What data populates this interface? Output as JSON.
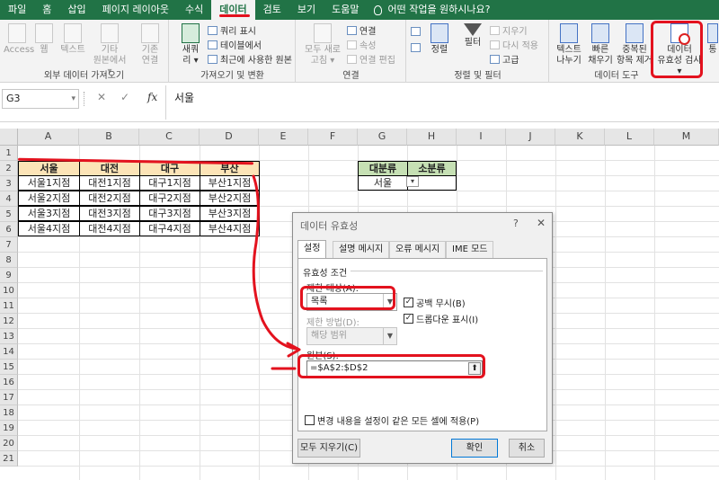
{
  "ribbon_tabs": [
    "파일",
    "홈",
    "삽입",
    "페이지 레이아웃",
    "수식",
    "데이터",
    "검토",
    "보기",
    "도움말"
  ],
  "active_tab": "데이터",
  "help_search": "어떤 작업을 원하시나요?",
  "ribbon": {
    "ext": {
      "label": "외부 데이터 가져오기",
      "access": "Access",
      "web": "웹",
      "text": "텍스트",
      "other_line1": "기타",
      "other_line2": "원본에서 ▾",
      "existing_line1": "기존",
      "existing_line2": "연결"
    },
    "get": {
      "label": "가져오기 및 변환",
      "new_query_line1": "새쿼",
      "new_query_line2": "리 ▾",
      "show_query": "쿼리 표시",
      "from_table": "테이블에서",
      "recent_sources": "최근에 사용한 원본"
    },
    "conn": {
      "label": "연결",
      "refresh_line1": "모두 새로",
      "refresh_line2": "고침 ▾",
      "connections": "연결",
      "properties": "속성",
      "edit_links": "연결 편집"
    },
    "sort": {
      "label": "정렬 및 필터",
      "sort": "정렬",
      "filter": "필터",
      "clear": "지우기",
      "reapply": "다시 적용",
      "advanced": "고급"
    },
    "tools": {
      "label": "데이터 도구",
      "text_to_cols_line1": "텍스트",
      "text_to_cols_line2": "나누기",
      "flash_fill_line1": "빠른",
      "flash_fill_line2": "채우기",
      "remove_dup_line1": "중복된",
      "remove_dup_line2": "항목 제거",
      "validation_line1": "데이터",
      "validation_line2": "유효성 검사 ▾",
      "cut_label": "통"
    }
  },
  "formula_bar": {
    "name_box": "G3",
    "formula": "서울"
  },
  "columns": [
    "A",
    "B",
    "C",
    "D",
    "E",
    "F",
    "G",
    "H",
    "I",
    "J",
    "K",
    "L",
    "M"
  ],
  "rows": [
    "1",
    "2",
    "3",
    "4",
    "5",
    "6",
    "7",
    "8",
    "9",
    "10",
    "11",
    "12",
    "13",
    "14",
    "15",
    "16",
    "17",
    "18",
    "19",
    "20",
    "21"
  ],
  "table": {
    "headers": [
      "서울",
      "대전",
      "대구",
      "부산"
    ],
    "rows": [
      [
        "서울1지점",
        "대전1지점",
        "대구1지점",
        "부산1지점"
      ],
      [
        "서울2지점",
        "대전2지점",
        "대구2지점",
        "부산2지점"
      ],
      [
        "서울3지점",
        "대전3지점",
        "대구3지점",
        "부산3지점"
      ],
      [
        "서울4지점",
        "대전4지점",
        "대구4지점",
        "부산4지점"
      ]
    ]
  },
  "category_table": {
    "header_major": "대분류",
    "header_minor": "소분류",
    "major_value": "서울"
  },
  "dialog": {
    "title": "데이터 유효성",
    "help": "?",
    "close": "✕",
    "tabs": [
      "설정",
      "설명 메시지",
      "오류 메시지",
      "IME 모드"
    ],
    "section": "유효성 조건",
    "allow_label": "제한 대상(A):",
    "allow_value": "목록",
    "ignore_blank": "공백 무시(B)",
    "data_label": "제한 방법(D):",
    "data_value": "해당 범위",
    "in_cell_dropdown": "드롭다운 표시(I)",
    "source_label": "원본(S):",
    "source_value": "=$A$2:$D$2",
    "apply_all": "변경 내용을 설정이 같은 모든 셀에 적용(P)",
    "clear_all": "모두 지우기(C)",
    "ok": "확인",
    "cancel": "취소"
  },
  "colors": {
    "excel_green": "#217346",
    "header_fill": "#fce4b7",
    "category_fill": "#c6e0b4",
    "annotation_red": "#e3121e"
  }
}
